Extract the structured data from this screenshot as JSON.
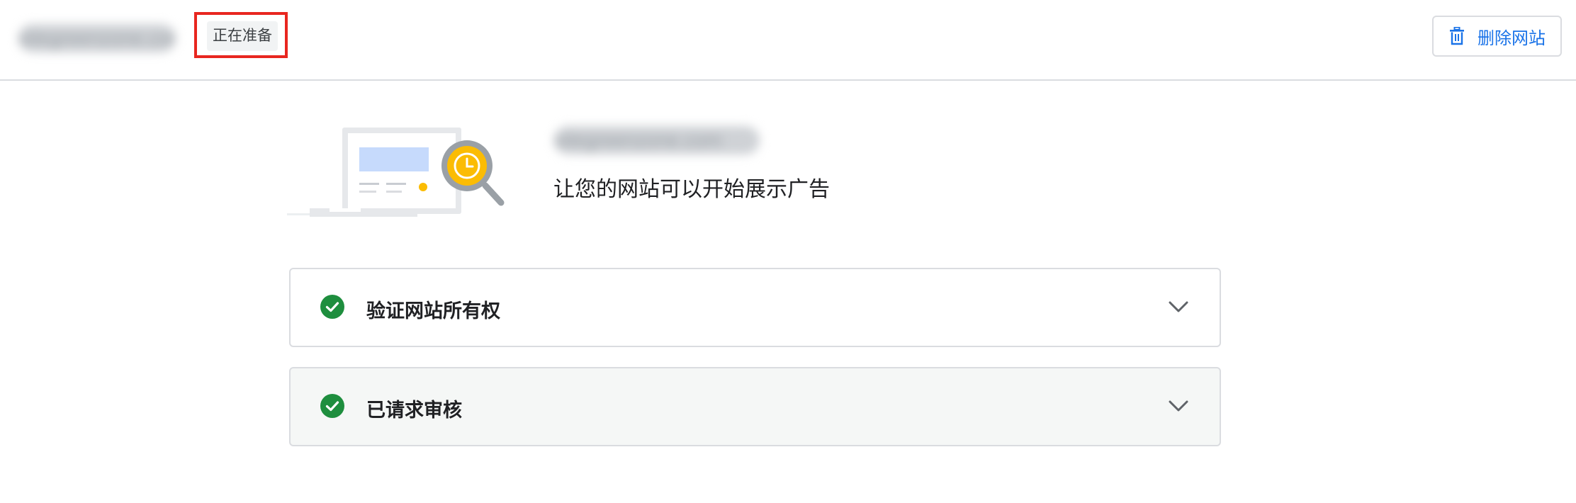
{
  "header": {
    "site_name": "sitegreenzone.com",
    "status_chip": "正在准备",
    "delete_button": {
      "label": "删除网站",
      "icon": "trash-icon"
    }
  },
  "hero": {
    "illustration": "site-review-illustration",
    "site_name": "sitegreenzone.com",
    "subtitle": "让您的网站可以开始展示广告"
  },
  "steps": [
    {
      "label": "验证网站所有权",
      "status": "complete",
      "icon": "check-circle-icon",
      "expand_icon": "chevron-down-icon"
    },
    {
      "label": "已请求审核",
      "status": "complete",
      "icon": "check-circle-icon",
      "expand_icon": "chevron-down-icon"
    }
  ],
  "colors": {
    "accent_blue": "#1a73e8",
    "success_green": "#1e8e3e",
    "highlight_red": "#e8261f",
    "illustration_yellow": "#fbbc04"
  }
}
